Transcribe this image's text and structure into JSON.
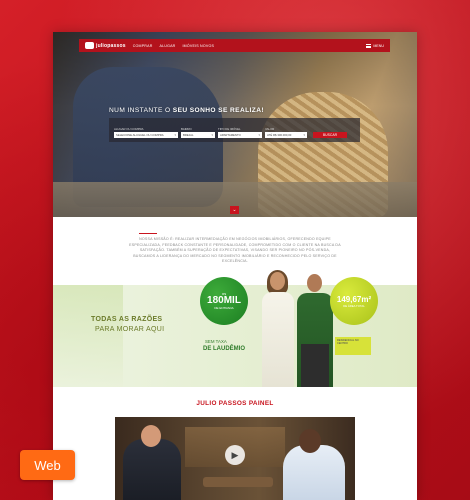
{
  "nav": {
    "logo": "juliopassos",
    "links": [
      "COMPRAR",
      "ALUGAR",
      "IMÓVEIS NOVOS"
    ],
    "menu_label": "MENU"
  },
  "hero": {
    "headline_prefix": "NUM INSTANTE O",
    "headline_highlight": "SEU SONHO SE REALIZA!",
    "search": {
      "fields": [
        {
          "label": "ALUGAR OU COMPRA",
          "value": "SELECIONE ALUGUEL OU COMPRA"
        },
        {
          "label": "BAIRRO",
          "value": "BREJAL"
        },
        {
          "label": "TIPO DE IMÓVEL",
          "value": "APARTAMENTO"
        },
        {
          "label": "VALOR",
          "value": "ATÉ R$ 300.000,00"
        }
      ],
      "button": "BUSCAR"
    }
  },
  "mission": {
    "text": "NOSSA MISSÃO É: REALIZAR INTERMEDIAÇÃO EM NEGÓCIOS IMOBILIÁRIOS, OFERECENDO EQUIPE ESPECIALIZADA, FEEDBACK CONSTANTE E PERSONALIDADE, COMPROMETIDO COM O CLIENTE NA BUSCA DA SATISFAÇÃO. TAMBÉM A SUPERAÇÃO DE EXPECTATIVAS, VISANDO SER PIONEIRO NO PÓS-VENDA, BUSCAMOS A LIDERANÇA DO MERCADO NO SEGMENTO IMOBILIÁRIO E RECONHECIDO PELO SERVIÇO DE EXCELÊNCIA."
  },
  "banner": {
    "title_line1": "TODAS AS RAZÕES",
    "title_line2": "PARA MORAR AQUI",
    "price_prefix": "R$",
    "price": "180MIL",
    "price_note": "DE ENTRADA",
    "area": "149,67m²",
    "area_note": "DE ÁREA TOTAL",
    "no_fee_line1": "SEM TAXA",
    "no_fee_line2": "DE LAUDÊMIO",
    "badge_text": "RESIDENCIAL NO CENTRO"
  },
  "painel": {
    "title": "JULIO PASSOS PAINEL"
  },
  "platform_badge": "Web",
  "colors": {
    "brand": "#c8141e",
    "accent": "#ff6a14",
    "green": "#1c7e22",
    "lime": "#a9c21a"
  }
}
